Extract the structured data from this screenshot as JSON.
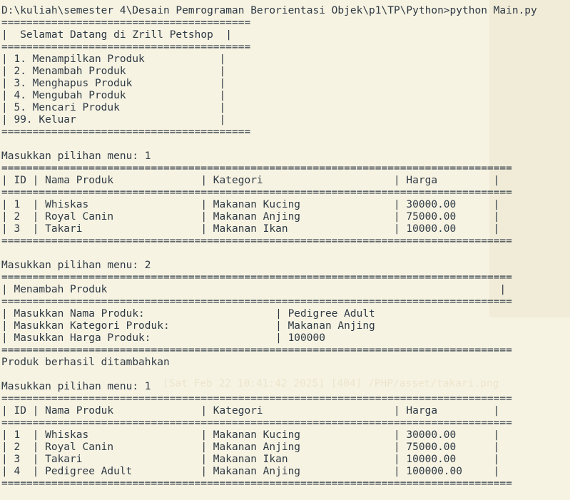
{
  "terminal": {
    "lines": [
      "D:\\kuliah\\semester 4\\Desain Pemrograman Berorientasi Objek\\p1\\TP\\Python>python Main.py",
      "========================================",
      "|  Selamat Datang di Zrill Petshop  |",
      "========================================",
      "| 1. Menampilkan Produk            |",
      "| 2. Menambah Produk               |",
      "| 3. Menghapus Produk              |",
      "| 4. Mengubah Produk               |",
      "| 5. Mencari Produk                |",
      "| 99. Keluar                       |",
      "========================================",
      "",
      "Masukkan pilihan menu: 1",
      "==================================================================================",
      "| ID | Nama Produk              | Kategori                     | Harga         |",
      "==================================================================================",
      "| 1  | Whiskas                  | Makanan Kucing               | 30000.00      |",
      "| 2  | Royal Canin              | Makanan Anjing               | 75000.00      |",
      "| 3  | Takari                   | Makanan Ikan                 | 10000.00      |",
      "==================================================================================",
      "",
      "Masukkan pilihan menu: 2",
      "==================================================================================",
      "| Menambah Produk                                                               |",
      "==================================================================================",
      "| Masukkan Nama Produk:                     | Pedigree Adult",
      "| Masukkan Kategori Produk:                 | Makanan Anjing",
      "| Masukkan Harga Produk:                    | 100000",
      "==================================================================================",
      "Produk berhasil ditambahkan",
      "",
      "Masukkan pilihan menu: 1",
      "==================================================================================",
      "| ID | Nama Produk              | Kategori                     | Harga         |",
      "==================================================================================",
      "| 1  | Whiskas                  | Makanan Kucing               | 30000.00      |",
      "| 2  | Royal Canin              | Makanan Anjing               | 75000.00      |",
      "| 3  | Takari                   | Makanan Ikan                 | 10000.00      |",
      "| 4  | Pedigree Adult           | Makanan Anjing               | 100000.00     |",
      "=================================================================================="
    ]
  },
  "colors": {
    "background": "#f7f3e3",
    "text": "#2e3a44"
  }
}
